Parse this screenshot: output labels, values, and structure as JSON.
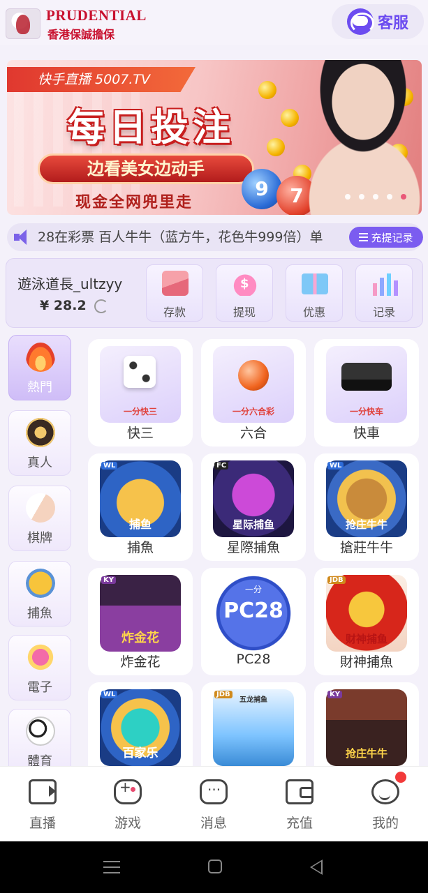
{
  "header": {
    "brand": "PRUDENTIAL",
    "brand_sub": "香港保誠擔保",
    "service_label": "客服"
  },
  "banner": {
    "tag": "快手直播 5007.TV",
    "title": "每日投注",
    "slogan": "边看美女边动手",
    "line3": "现金全网兜里走",
    "ball_numbers": [
      "9",
      "7"
    ],
    "slide_count": 5,
    "active_slide": 5
  },
  "marquee": {
    "text": "28在彩票  百人牛牛（蓝方牛，花色牛999倍）单",
    "record_button": "充提记录"
  },
  "user": {
    "username": "遊泳道長_ultzyy",
    "balance": "¥ 28.2"
  },
  "quick_actions": [
    {
      "label": "存款",
      "icon": "card-icon"
    },
    {
      "label": "提现",
      "icon": "money-bag-icon"
    },
    {
      "label": "优惠",
      "icon": "gift-icon"
    },
    {
      "label": "记录",
      "icon": "bar-chart-icon"
    }
  ],
  "categories": [
    {
      "label": "熱門",
      "icon": "fire-icon",
      "active": true
    },
    {
      "label": "真人",
      "icon": "casino-chip-icon",
      "active": false
    },
    {
      "label": "棋牌",
      "icon": "playing-card-icon",
      "active": false
    },
    {
      "label": "捕魚",
      "icon": "fish-icon",
      "active": false
    },
    {
      "label": "電子",
      "icon": "slot-777-icon",
      "active": false
    },
    {
      "label": "體育",
      "icon": "soccer-ball-icon",
      "active": false
    }
  ],
  "games": [
    {
      "name": "快三",
      "thumb_text": "一分快三"
    },
    {
      "name": "六合",
      "thumb_text": "一分六合彩"
    },
    {
      "name": "快車",
      "thumb_text": "一分快车"
    },
    {
      "name": "捕魚",
      "thumb_text": "捕鱼"
    },
    {
      "name": "星際捕魚",
      "thumb_text": "星际捕鱼"
    },
    {
      "name": "搶莊牛牛",
      "thumb_text": "抢庄牛牛"
    },
    {
      "name": "炸金花",
      "thumb_text": "炸金花"
    },
    {
      "name": "PC28",
      "thumb_text": "PC28",
      "thumb_sub": "一分"
    },
    {
      "name": "財神捕魚",
      "thumb_text": "财神捕鱼"
    },
    {
      "name": "",
      "thumb_text": "百家乐"
    },
    {
      "name": "",
      "thumb_text": "五龙捕鱼"
    },
    {
      "name": "",
      "thumb_text": "抢庄牛牛"
    }
  ],
  "tabs": [
    {
      "label": "直播",
      "icon": "video-camera-icon"
    },
    {
      "label": "游戏",
      "icon": "gamepad-icon"
    },
    {
      "label": "消息",
      "icon": "chat-bubble-icon"
    },
    {
      "label": "充值",
      "icon": "wallet-icon"
    },
    {
      "label": "我的",
      "icon": "smiley-user-icon"
    }
  ],
  "colors": {
    "accent": "#7b5cf0",
    "brand_red": "#c8102e",
    "notification": "#f23a3a"
  }
}
